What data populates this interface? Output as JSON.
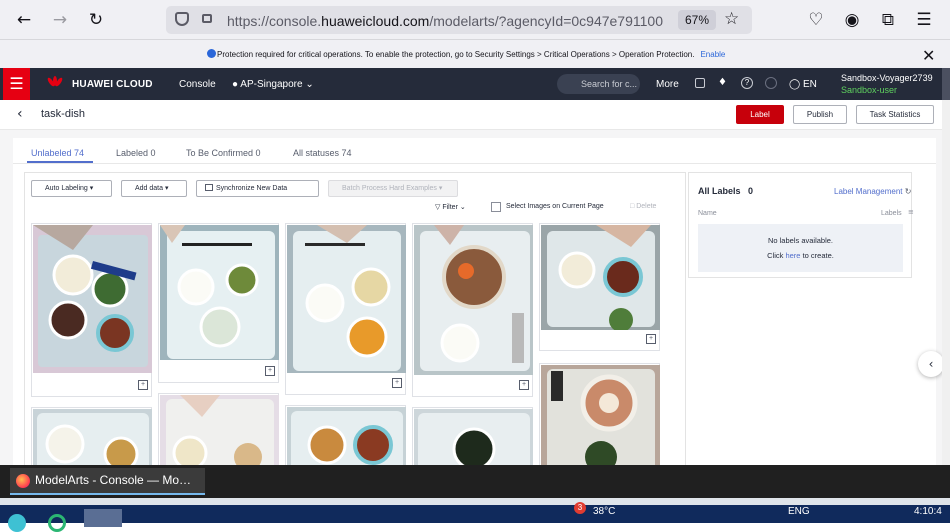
{
  "browser": {
    "url_prefix": "https://console.",
    "url_domain": "huaweicloud.com",
    "url_suffix": "/modelarts/?agencyId=0c947e791100",
    "zoom": "67%"
  },
  "notice": {
    "text": "Protection required for critical operations. To enable the protection, go to Security Settings > Critical Operations > Operation Protection.",
    "link": "Enable"
  },
  "header": {
    "brand": "HUAWEI CLOUD",
    "console": "Console",
    "region": "AP-Singapore",
    "search_placeholder": "Search for c...",
    "more": "More",
    "lang": "EN",
    "user": "Sandbox-Voyager2739",
    "role": "Sandbox-user"
  },
  "task": {
    "title": "task-dish",
    "btn_label": "Label",
    "btn_publish": "Publish",
    "btn_stats": "Task Statistics"
  },
  "tabs": [
    {
      "label": "Unlabeled 74"
    },
    {
      "label": "Labeled 0"
    },
    {
      "label": "To Be Confirmed 0"
    },
    {
      "label": "All statuses 74"
    }
  ],
  "toolbar": {
    "auto_labeling": "Auto Labeling",
    "add_data": "Add data",
    "sync": "Synchronize New Data",
    "batch": "Batch Process Hard Examples",
    "filter": "Filter",
    "select_page": "Select Images on Current Page",
    "delete": "Delete"
  },
  "labels_panel": {
    "title": "All Labels",
    "count": "0",
    "management": "Label Management",
    "col_name": "Name",
    "col_labels": "Labels",
    "empty_line1": "No labels available.",
    "empty_click": "Click",
    "empty_here": "here",
    "empty_rest": "to create."
  },
  "taskbar": {
    "window": "ModelArts - Console — Mo…",
    "weather": "38°C",
    "lang": "ENG",
    "time": "4:10:4"
  }
}
